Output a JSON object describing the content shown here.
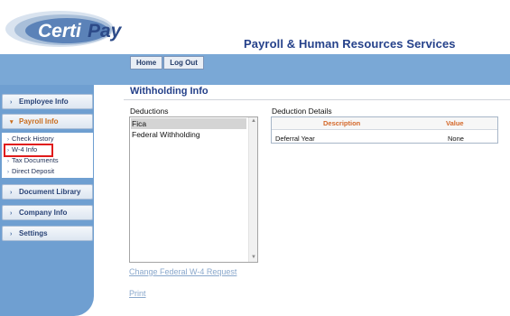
{
  "brand": {
    "logo_text_1": "Certi",
    "logo_text_2": "Pay",
    "header_title": "Payroll & Human Resources Services"
  },
  "topnav": {
    "home": "Home",
    "logout": "Log Out"
  },
  "sidebar": {
    "employee_info": "Employee Info",
    "payroll_info": "Payroll Info",
    "payroll_items": [
      "Check History",
      "W-4 Info",
      "Tax Documents",
      "Direct Deposit"
    ],
    "document_library": "Document Library",
    "company_info": "Company Info",
    "settings": "Settings"
  },
  "main": {
    "title": "Withholding Info",
    "deductions_label": "Deductions",
    "deductions": [
      "Fica",
      "Federal Withholding"
    ],
    "selected_deduction": "Fica",
    "details_label": "Deduction Details",
    "details_columns": [
      "Description",
      "Value"
    ],
    "details_rows": [
      {
        "description": "Deferral Year",
        "value": "None"
      }
    ],
    "change_link": "Change Federal W-4 Request",
    "print_link": "Print"
  },
  "colors": {
    "accent": "#25418a",
    "band": "#7aa8d6",
    "orange": "#d4682a",
    "link": "#8aa8cc",
    "highlight_box": "#e01b1b"
  }
}
